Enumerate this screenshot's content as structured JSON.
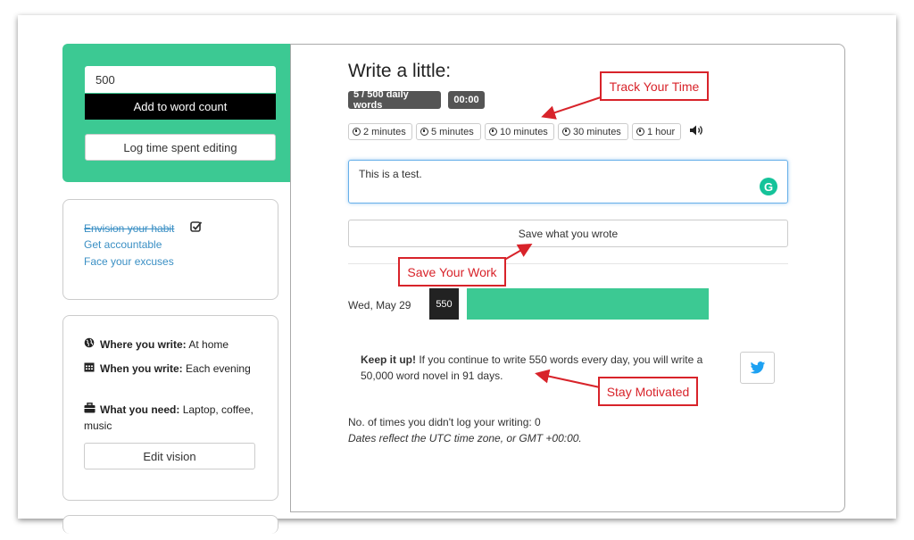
{
  "sidebar": {
    "word_input_value": "500",
    "add_button": "Add to word count",
    "log_button": "Log time spent editing",
    "habit_links": [
      "Envision your habit",
      "Get accountable",
      "Face your excuses"
    ],
    "vision": {
      "where_label": "Where you write:",
      "where_value": "At home",
      "when_label": "When you write:",
      "when_value": "Each evening",
      "need_label": "What you need:",
      "need_value": "Laptop, coffee, music",
      "edit_button": "Edit vision"
    }
  },
  "main": {
    "title": "Write a little:",
    "daily_badge": "5 / 500 daily words",
    "timer_badge": "00:00",
    "timers": [
      "2 minutes",
      "5 minutes",
      "10 minutes",
      "30 minutes",
      "1 hour"
    ],
    "textarea_value": "This is a test.",
    "save_button": "Save what you wrote",
    "entry": {
      "date": "Wed, May 29",
      "count": "550",
      "progress": 1.0
    },
    "motivation_bold": "Keep it up!",
    "motivation_text": " If you continue to write 550 words every day, you will write a 50,000 word novel in 91 days.",
    "missed_text": "No. of times you didn't log your writing: 0",
    "timezone_note": "Dates reflect the UTC time zone, or GMT +00:00."
  },
  "callouts": {
    "track": "Track Your Time",
    "save": "Save Your Work",
    "motivate": "Stay Motivated"
  },
  "colors": {
    "accent_green": "#3cc993",
    "link_blue": "#3a8fc4",
    "callout_red": "#d8232a",
    "twitter_blue": "#1da1f2"
  },
  "icons": [
    "globe-icon",
    "calendar-icon",
    "briefcase-icon",
    "check-square-icon",
    "clock-icon",
    "speaker-icon",
    "grammarly-icon",
    "twitter-icon"
  ]
}
